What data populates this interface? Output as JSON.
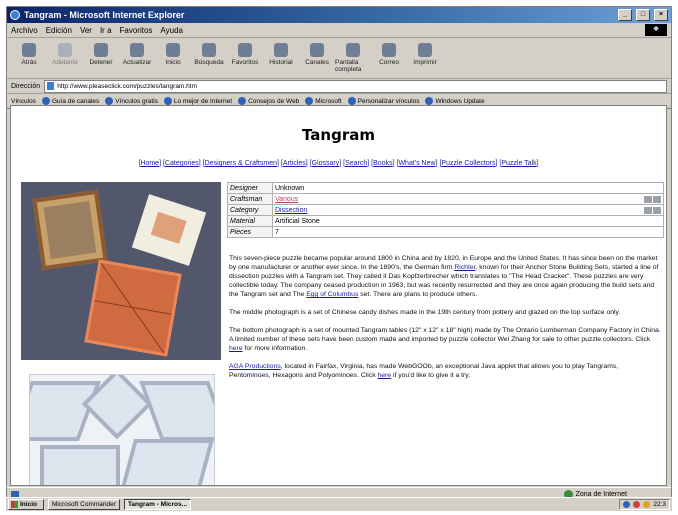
{
  "window": {
    "title": "Tangram - Microsoft Internet Explorer",
    "min": "_",
    "max": "□",
    "close": "×"
  },
  "menu": [
    "Archivo",
    "Edición",
    "Ver",
    "Ir a",
    "Favoritos",
    "Ayuda"
  ],
  "toolbar": [
    {
      "label": "Atrás",
      "icon": "back-arrow-icon",
      "dim": false
    },
    {
      "label": "Adelante",
      "icon": "forward-arrow-icon",
      "dim": true
    },
    {
      "label": "Detener",
      "icon": "stop-icon",
      "dim": false
    },
    {
      "label": "Actualizar",
      "icon": "refresh-icon",
      "dim": false
    },
    {
      "label": "Inicio",
      "icon": "home-icon",
      "dim": false
    },
    {
      "label": "Búsqueda",
      "icon": "search-icon",
      "dim": false
    },
    {
      "label": "Favoritos",
      "icon": "favorites-icon",
      "dim": false
    },
    {
      "label": "Historial",
      "icon": "history-icon",
      "dim": false
    },
    {
      "label": "Canales",
      "icon": "channels-icon",
      "dim": false
    },
    {
      "label": "Pantalla completa",
      "icon": "fullscreen-icon",
      "dim": false
    },
    {
      "label": "Correo",
      "icon": "mail-icon",
      "dim": false
    },
    {
      "label": "Imprimir",
      "icon": "print-icon",
      "dim": false
    }
  ],
  "address": {
    "label": "Dirección",
    "url": "http://www.pleaseclick.com/puzzles/tangram.htm"
  },
  "links": {
    "label": "Vínculos",
    "items": [
      "Guía de canales",
      "Vínculos gratis",
      "Lo mejor de Internet",
      "Consejos de Web",
      "Microsoft",
      "Personalizar vínculos",
      "Windows Update"
    ]
  },
  "page": {
    "title": "Tangram",
    "nav": [
      "Home",
      "Categories",
      "Designers & Craftsmen",
      "Articles",
      "Glossary",
      "Search",
      "Books",
      "What's New",
      "Puzzle Collectors",
      "Puzzle Talk"
    ],
    "info": {
      "rows": [
        {
          "label": "Designer",
          "value": "Unknown",
          "style": "plain",
          "buttons": false
        },
        {
          "label": "Craftsman",
          "value": "Various",
          "style": "pink",
          "buttons": true
        },
        {
          "label": "Category",
          "value": "Dissection",
          "style": "blue",
          "buttons": true
        },
        {
          "label": "Material",
          "value": "Artificial Stone",
          "style": "plain",
          "buttons": false
        },
        {
          "label": "Pieces",
          "value": "7",
          "style": "plain",
          "buttons": false
        }
      ]
    },
    "desc": {
      "p1a": "This seven-piece puzzle became popular around 1800 in China and by 1820, in Europe and the United States. It has since been on the market by one manufacturer or another ever since. In the 1890's, the German firm ",
      "p1_link1": "Richter",
      "p1b": ", known for their Anchor Stone Building Sets, started a line of dissection puzzles with a Tangram set. They called it Das Kopfzerbrecher which translates to \"The Head Cracker\". These puzzles are very collectible today. The company ceased production in 1963, but was recently resurrected and they are once again producing the build sets and the Tangram set and The ",
      "p1_link2": "Egg of Columbus",
      "p1c": " set. There are plans to produce others.",
      "p2": "The middle photograph is a set of Chinese candy dishes made in the 19th century from pottery and glazed on the top surface only.",
      "p3a": "The bottom photograph is a set of mounted Tangram tables (12\" x 12\" x 18\" high) made by The Ontario Lumberman Company Factory in China. A limited number of these sets have been custom made and imported by puzzle collector Wei Zhang for sale to other puzzle collectors. Click ",
      "p3_link": "here",
      "p3b": " for more information.",
      "p4_link": "AGA Productions",
      "p4a": ", located in Fairfax, Virginia, has made WebGOOb, an exceptional Java applet that allows you to play Tangrams, Pentominoes, Hexagons and Polyominoes. Click ",
      "p4_link2": "here",
      "p4b": " if you'd like to give it a try."
    }
  },
  "status": {
    "zone": "Zona de Internet"
  },
  "taskbar": {
    "start": "Inicio",
    "tasks": [
      "Microsoft Commander",
      "Tangram - Micros..."
    ],
    "clock": "22:3"
  },
  "colors": {
    "titlebar": "#0a246a",
    "link": "#1a1aa8",
    "chrome": "#d4d0c8"
  }
}
